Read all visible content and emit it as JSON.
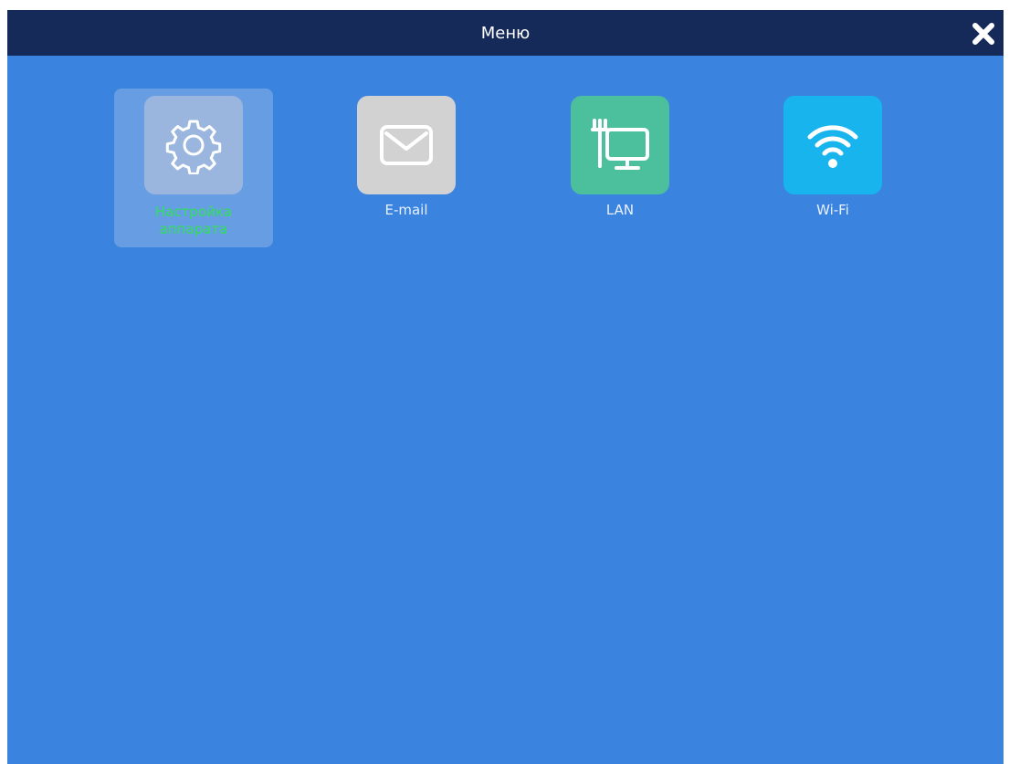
{
  "window": {
    "title": "Меню",
    "close_icon": "close-icon"
  },
  "colors": {
    "header_bg": "#162a5a",
    "panel_bg": "#3a84df",
    "selected_label": "#2fe05a",
    "label": "#e8f0ff"
  },
  "menu": {
    "items": [
      {
        "label": "Настройка аппарата",
        "icon": "gear-icon",
        "tile_color": "#9ab6df",
        "selected": true
      },
      {
        "label": "E-mail",
        "icon": "envelope-icon",
        "tile_color": "#d2d2d2",
        "selected": false
      },
      {
        "label": "LAN",
        "icon": "lan-monitor-icon",
        "tile_color": "#4cbf9c",
        "selected": false
      },
      {
        "label": "Wi-Fi",
        "icon": "wifi-icon",
        "tile_color": "#18b4ee",
        "selected": false
      }
    ]
  }
}
